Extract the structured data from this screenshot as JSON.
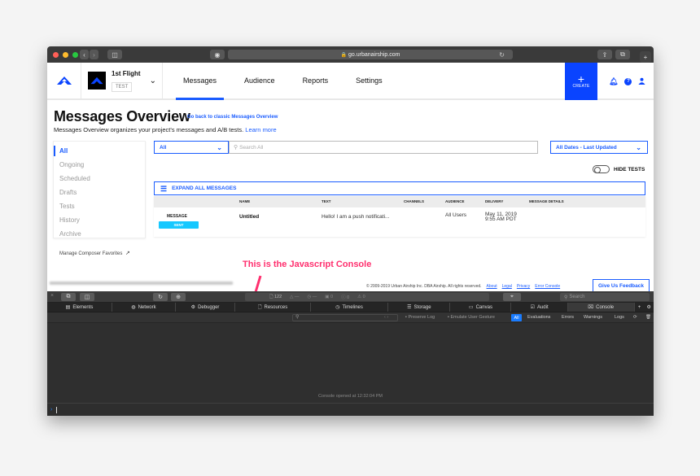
{
  "browser": {
    "url": "go.urbanairship.com"
  },
  "header": {
    "project_name": "1st Flight",
    "project_badge": "TEST",
    "nav": [
      {
        "label": "Messages",
        "active": true
      },
      {
        "label": "Audience",
        "active": false
      },
      {
        "label": "Reports",
        "active": false
      },
      {
        "label": "Settings",
        "active": false
      }
    ],
    "create_label": "CREATE",
    "accent_color": "#0a44ff"
  },
  "page": {
    "title": "Messages Overview",
    "classic_link": "Go back to classic Messages Overview",
    "subtitle": "Messages Overview organizes your project's messages and A/B tests.",
    "learn_more": "Learn more"
  },
  "sidebar": {
    "items": [
      {
        "label": "All",
        "active": true
      },
      {
        "label": "Ongoing"
      },
      {
        "label": "Scheduled"
      },
      {
        "label": "Drafts"
      },
      {
        "label": "Tests"
      },
      {
        "label": "History"
      },
      {
        "label": "Archive"
      }
    ],
    "manage_favorites": "Manage Composer Favorites"
  },
  "filters": {
    "type_select": "All",
    "search_placeholder": "Search All",
    "date_select": "All Dates - Last Updated",
    "hide_tests_label": "HIDE TESTS",
    "hide_tests_on": false
  },
  "messages": {
    "expand_label": "EXPAND ALL MESSAGES",
    "columns": [
      "NAME",
      "TEXT",
      "CHANNELS",
      "AUDIENCE",
      "DELIVERY",
      "MESSAGE DETAILS"
    ],
    "rows": [
      {
        "type": "MESSAGE",
        "status": "SENT",
        "name": "Untitled",
        "text": "Hello! I am a push notificati...",
        "channel_icon": "apple-icon",
        "audience": "All Users",
        "delivery_date": "May 11, 2019",
        "delivery_time": "9:55 AM PDT",
        "details": ""
      }
    ]
  },
  "annotation": {
    "text": "This is the Javascript Console",
    "color": "#ff2f6e"
  },
  "footer": {
    "copyright": "© 2009-2019 Urban Airship Inc. DBA Airship. All rights reserved.",
    "links": [
      "About",
      "Legal",
      "Privacy",
      "Error Console"
    ],
    "feedback": "Give Us Feedback"
  },
  "devtools": {
    "resource_count": "122",
    "status_dash_1": "—",
    "status_dash_2": "—",
    "errors": "0",
    "warnings_count": "0",
    "alerts": "0",
    "search_placeholder": "Search",
    "tabs": [
      {
        "label": "Elements",
        "icon": "elements-icon"
      },
      {
        "label": "Network",
        "icon": "network-icon"
      },
      {
        "label": "Debugger",
        "icon": "debugger-icon"
      },
      {
        "label": "Resources",
        "icon": "resources-icon"
      },
      {
        "label": "Timelines",
        "icon": "timelines-icon"
      },
      {
        "label": "Storage",
        "icon": "storage-icon"
      },
      {
        "label": "Canvas",
        "icon": "canvas-icon"
      },
      {
        "label": "Audit",
        "icon": "audit-icon"
      },
      {
        "label": "Console",
        "icon": "console-icon",
        "active": true
      }
    ],
    "filter": {
      "preserve_log": "Preserve Log",
      "emulate_gesture": "Emulate User Gesture",
      "levels": [
        "All",
        "Evaluations",
        "Errors",
        "Warnings",
        "Logs"
      ]
    },
    "console_message": "Console opened at 12:32:04 PM"
  }
}
